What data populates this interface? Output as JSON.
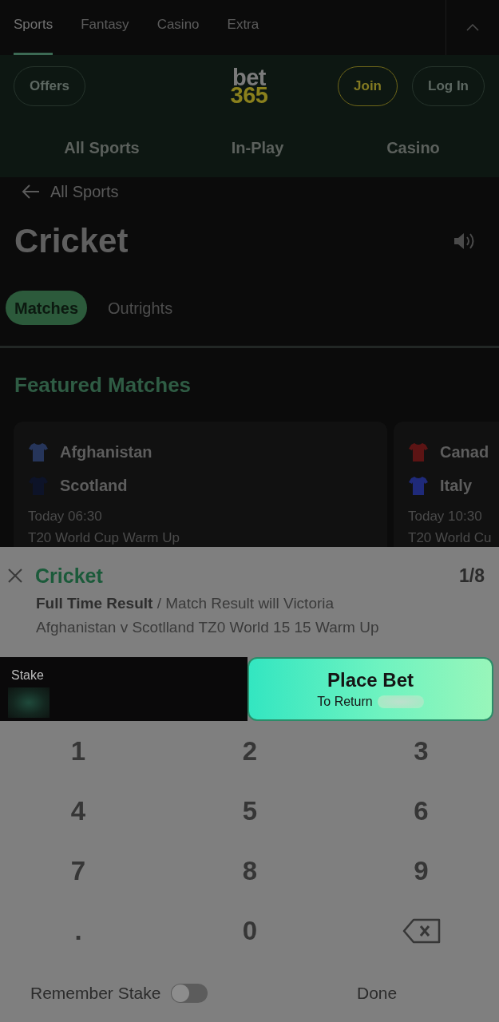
{
  "top_nav": {
    "tabs": [
      {
        "label": "Sports",
        "selected": true
      },
      {
        "label": "Fantasy",
        "selected": false
      },
      {
        "label": "Casino",
        "selected": false
      },
      {
        "label": "Extra",
        "selected": false
      }
    ]
  },
  "header": {
    "offers_button": "Offers",
    "logo": {
      "line_1": "bet",
      "line_2": "365"
    },
    "join_button": "Join",
    "login_button": "Log In",
    "nav": [
      "All Sports",
      "In-Play",
      "Casino"
    ]
  },
  "back_link": "All Sports",
  "title": "Cricket",
  "tabs": [
    {
      "label": "Matches",
      "selected": true
    },
    {
      "label": "Outrights",
      "selected": false
    }
  ],
  "featured": {
    "title": "Featured Matches",
    "matches": [
      {
        "teams": [
          {
            "name": "Afghanistan",
            "color": "#26355a"
          },
          {
            "name": "Scotland",
            "color": "#0d1328"
          }
        ],
        "time": "Today 06:30",
        "competition": "T20 World Cup Warm Up"
      },
      {
        "teams": [
          {
            "name": "Canad",
            "color": "#5c1414"
          },
          {
            "name": "Italy",
            "color": "#1f2a7a"
          }
        ],
        "time": "Today 10:30",
        "competition": "T20 World Cu"
      }
    ]
  },
  "bet_slip": {
    "sport": "Cricket",
    "count": "1/8",
    "market": "**Full Time Result** / Match Result will Victoria",
    "event": "Afghanistan v Scotlland TZ0 World 15 15 Warm Up",
    "stake_label": "Stake",
    "place_bet": "Place Bet",
    "to_return": "To Return"
  },
  "keypad": [
    {
      "kind": "key",
      "label": "1"
    },
    {
      "kind": "key",
      "label": "2"
    },
    {
      "kind": "key",
      "label": "3"
    },
    {
      "kind": "key",
      "label": "4"
    },
    {
      "kind": "key",
      "label": "5"
    },
    {
      "kind": "key",
      "label": "6"
    },
    {
      "kind": "key",
      "label": "7"
    },
    {
      "kind": "key",
      "label": "8"
    },
    {
      "kind": "key",
      "label": "9"
    },
    {
      "kind": "key",
      "label": "."
    },
    {
      "kind": "key",
      "label": "0"
    },
    {
      "kind": "backspace"
    }
  ],
  "remember_stake": {
    "label": "Remember Stake",
    "on": false
  },
  "done": "Done"
}
